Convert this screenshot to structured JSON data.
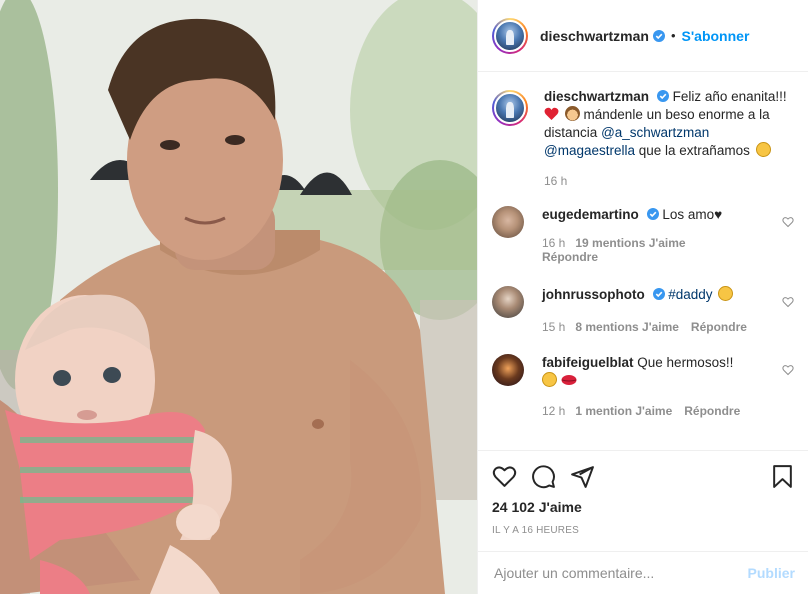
{
  "post": {
    "author": "dieschwartzman",
    "follow_label": "S'abonner",
    "dot": "•",
    "icons": {
      "verified": "verified-badge-icon",
      "like": "heart-icon",
      "comment": "comment-bubble-icon",
      "share": "paper-plane-icon",
      "save": "bookmark-icon"
    },
    "caption": {
      "user": "dieschwartzman",
      "line1": "Feliz año enanita!!!",
      "line2": "mándenle un beso enorme a la distancia",
      "mention1": "@a_schwartzman",
      "mention2": "@magaestrella",
      "line3": "que la extrañamos",
      "time": "16 h"
    },
    "comments": [
      {
        "user": "eugedemartino",
        "text": "Los amo♥",
        "time": "16 h",
        "likes": "19 mentions J'aime",
        "reply": "Répondre"
      },
      {
        "user": "johnrussophoto",
        "text": "#daddy",
        "time": "15 h",
        "likes": "8 mentions J'aime",
        "reply": "Répondre"
      },
      {
        "user": "fabifeiguelblat",
        "text": "Que hermosos!!",
        "time": "12 h",
        "likes": "1 mention J'aime",
        "reply": "Répondre"
      }
    ],
    "likes_count": "24 102 J'aime",
    "posted_ago": "IL Y A 16 HEURES",
    "add_comment_placeholder": "Ajouter un commentaire...",
    "publish_label": "Publier",
    "colors": {
      "link_blue": "#0095f6",
      "mention": "#00376b",
      "muted": "#8e8e8e",
      "publish_disabled": "#b3dbff",
      "heart_red": "#ed4956"
    }
  }
}
